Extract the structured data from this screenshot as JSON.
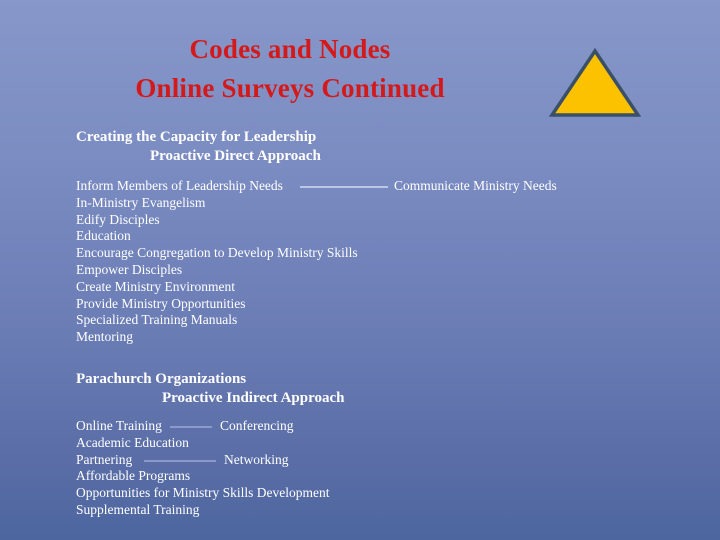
{
  "slide": {
    "background_top_color": "#8797c9",
    "background_bottom_color": "#4d66a0",
    "title_color": "#d4191b",
    "body_text_color": "#ffffff",
    "connector_color": "#b9c6e4",
    "title": {
      "line1": "Codes and Nodes",
      "line2": "Online Surveys Continued"
    },
    "decoration": {
      "triangle_fill": "#fcc200",
      "triangle_stroke": "#3a5068"
    },
    "sections": [
      {
        "heading": "Creating the Capacity for Leadership",
        "subheading": "Proactive Direct Approach",
        "items": [
          {
            "text": "Inform Members of Leadership Needs",
            "connector": true,
            "right_text": "Communicate Ministry Needs"
          },
          {
            "text": "In-Ministry Evangelism",
            "connector": false,
            "right_text": ""
          },
          {
            "text": "Edify Disciples",
            "connector": false,
            "right_text": ""
          },
          {
            "text": "Education",
            "connector": false,
            "right_text": ""
          },
          {
            "text": "Encourage Congregation to Develop Ministry Skills",
            "connector": false,
            "right_text": ""
          },
          {
            "text": "Empower Disciples",
            "connector": false,
            "right_text": ""
          },
          {
            "text": "Create Ministry Environment",
            "connector": false,
            "right_text": ""
          },
          {
            "text": "Provide Ministry Opportunities",
            "connector": false,
            "right_text": ""
          },
          {
            "text": "Specialized Training Manuals",
            "connector": false,
            "right_text": ""
          },
          {
            "text": "Mentoring",
            "connector": false,
            "right_text": ""
          }
        ]
      },
      {
        "heading": "Parachurch Organizations",
        "subheading": "Proactive Indirect Approach",
        "items": [
          {
            "text": "Online Training",
            "connector": true,
            "right_text": "Conferencing"
          },
          {
            "text": "Academic Education",
            "connector": false,
            "right_text": ""
          },
          {
            "text": "Partnering",
            "connector": true,
            "right_text": "Networking"
          },
          {
            "text": "Affordable Programs",
            "connector": false,
            "right_text": ""
          },
          {
            "text": "Opportunities for Ministry Skills Development",
            "connector": false,
            "right_text": ""
          },
          {
            "text": "Supplemental Training",
            "connector": false,
            "right_text": ""
          }
        ]
      }
    ]
  }
}
